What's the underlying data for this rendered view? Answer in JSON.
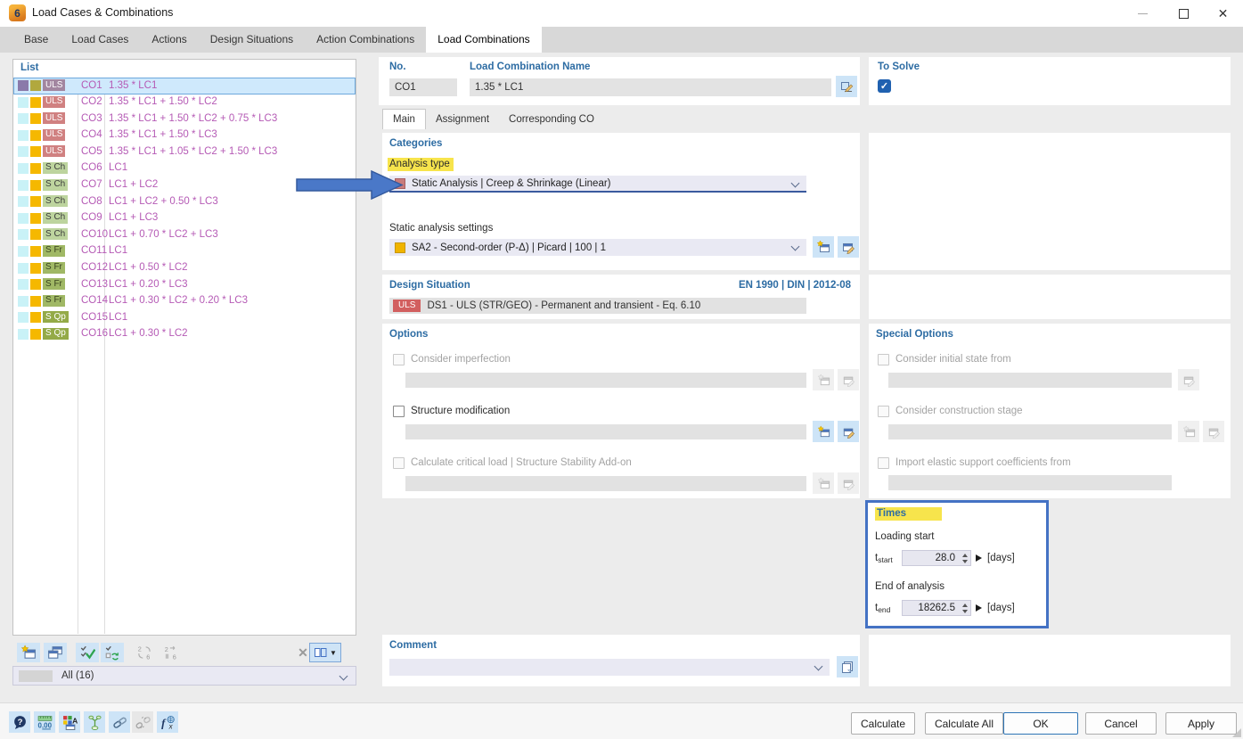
{
  "window": {
    "title": "Load Cases & Combinations",
    "controls": [
      "minimize",
      "maximize",
      "close"
    ]
  },
  "tabs": {
    "items": [
      "Base",
      "Load Cases",
      "Actions",
      "Design Situations",
      "Action Combinations",
      "Load Combinations"
    ],
    "active": "Load Combinations"
  },
  "list": {
    "header": "List",
    "rows": [
      {
        "id": "CO1",
        "badge": "ULS",
        "formula": "1.35 * LC1",
        "selected": true,
        "squares": [
          "#8a7aaa",
          "#b1a83e"
        ]
      },
      {
        "id": "CO2",
        "badge": "ULS",
        "formula": "1.35 * LC1 + 1.50 * LC2",
        "squares": [
          "#c9f2f7",
          "#f5b800"
        ]
      },
      {
        "id": "CO3",
        "badge": "ULS",
        "formula": "1.35 * LC1 + 1.50 * LC2 + 0.75 * LC3",
        "squares": [
          "#c9f2f7",
          "#f5b800"
        ]
      },
      {
        "id": "CO4",
        "badge": "ULS",
        "formula": "1.35 * LC1 + 1.50 * LC3",
        "squares": [
          "#c9f2f7",
          "#f5b800"
        ]
      },
      {
        "id": "CO5",
        "badge": "ULS",
        "formula": "1.35 * LC1 + 1.05 * LC2 + 1.50 * LC3",
        "squares": [
          "#c9f2f7",
          "#f5b800"
        ]
      },
      {
        "id": "CO6",
        "badge": "S Ch",
        "formula": "LC1",
        "squares": [
          "#c9f2f7",
          "#f5b800"
        ]
      },
      {
        "id": "CO7",
        "badge": "S Ch",
        "formula": "LC1 + LC2",
        "squares": [
          "#c9f2f7",
          "#f5b800"
        ]
      },
      {
        "id": "CO8",
        "badge": "S Ch",
        "formula": "LC1 + LC2 + 0.50 * LC3",
        "squares": [
          "#c9f2f7",
          "#f5b800"
        ]
      },
      {
        "id": "CO9",
        "badge": "S Ch",
        "formula": "LC1 + LC3",
        "squares": [
          "#c9f2f7",
          "#f5b800"
        ]
      },
      {
        "id": "CO10",
        "badge": "S Ch",
        "formula": "LC1 + 0.70 * LC2 + LC3",
        "squares": [
          "#c9f2f7",
          "#f5b800"
        ]
      },
      {
        "id": "CO11",
        "badge": "S Fr",
        "formula": "LC1",
        "squares": [
          "#c9f2f7",
          "#f5b800"
        ]
      },
      {
        "id": "CO12",
        "badge": "S Fr",
        "formula": "LC1 + 0.50 * LC2",
        "squares": [
          "#c9f2f7",
          "#f5b800"
        ]
      },
      {
        "id": "CO13",
        "badge": "S Fr",
        "formula": "LC1 + 0.20 * LC3",
        "squares": [
          "#c9f2f7",
          "#f5b800"
        ]
      },
      {
        "id": "CO14",
        "badge": "S Fr",
        "formula": "LC1 + 0.30 * LC2 + 0.20 * LC3",
        "squares": [
          "#c9f2f7",
          "#f5b800"
        ]
      },
      {
        "id": "CO15",
        "badge": "S Qp",
        "formula": "LC1",
        "squares": [
          "#c9f2f7",
          "#f5b800"
        ]
      },
      {
        "id": "CO16",
        "badge": "S Qp",
        "formula": "LC1 + 0.30 * LC2",
        "squares": [
          "#c9f2f7",
          "#f5b800"
        ]
      }
    ],
    "toolbar_icons": [
      "new",
      "copy",
      "check-all",
      "check-refresh",
      "renumber",
      "renumber-assign",
      "delete",
      "columns"
    ],
    "filter_value": "All (16)"
  },
  "record": {
    "no_label": "No.",
    "no_value": "CO1",
    "name_label": "Load Combination Name",
    "name_value": "1.35 * LC1",
    "to_solve_label": "To Solve",
    "to_solve_checked": true
  },
  "subtabs": {
    "items": [
      "Main",
      "Assignment",
      "Corresponding CO"
    ],
    "active": "Main"
  },
  "categories": {
    "header": "Categories",
    "analysis_type_label": "Analysis type",
    "analysis_type_value": "Static Analysis | Creep & Shrinkage (Linear)",
    "settings_label": "Static analysis settings",
    "settings_value": "SA2 - Second-order (P-Δ) | Picard | 100 | 1"
  },
  "design_situation": {
    "header": "Design Situation",
    "standard": "EN 1990 | DIN | 2012-08",
    "badge": "ULS",
    "value": "DS1 - ULS (STR/GEO) - Permanent and transient - Eq. 6.10"
  },
  "options": {
    "header": "Options",
    "items": [
      {
        "label": "Consider imperfection",
        "enabled": false,
        "checked": false
      },
      {
        "label": "Structure modification",
        "enabled": true,
        "checked": false
      },
      {
        "label": "Calculate critical load | Structure Stability Add-on",
        "enabled": false,
        "checked": false
      }
    ]
  },
  "special_options": {
    "header": "Special Options",
    "items": [
      {
        "label": "Consider initial state from",
        "enabled": false,
        "checked": false
      },
      {
        "label": "Consider construction stage",
        "enabled": false,
        "checked": false
      },
      {
        "label": "Import elastic support coefficients from",
        "enabled": false,
        "checked": false
      }
    ]
  },
  "times": {
    "header": "Times",
    "loading_start_label": "Loading start",
    "tstart_symbol": "t",
    "tstart_sub": "start",
    "tstart_value": "28.0",
    "end_label": "End of analysis",
    "tend_symbol": "t",
    "tend_sub": "end",
    "tend_value": "18262.5",
    "unit": "[days]"
  },
  "comment": {
    "header": "Comment"
  },
  "footer": {
    "icons": [
      "help",
      "units",
      "display-settings",
      "model-tree",
      "link",
      "unlink",
      "formula"
    ],
    "calculate": "Calculate",
    "calculate_all": "Calculate All",
    "ok": "OK",
    "cancel": "Cancel",
    "apply": "Apply"
  },
  "annotations": {
    "arrow_color": "#4a78c8",
    "highlight_color": "#f7e44c",
    "times_box_color": "#4472c4"
  }
}
